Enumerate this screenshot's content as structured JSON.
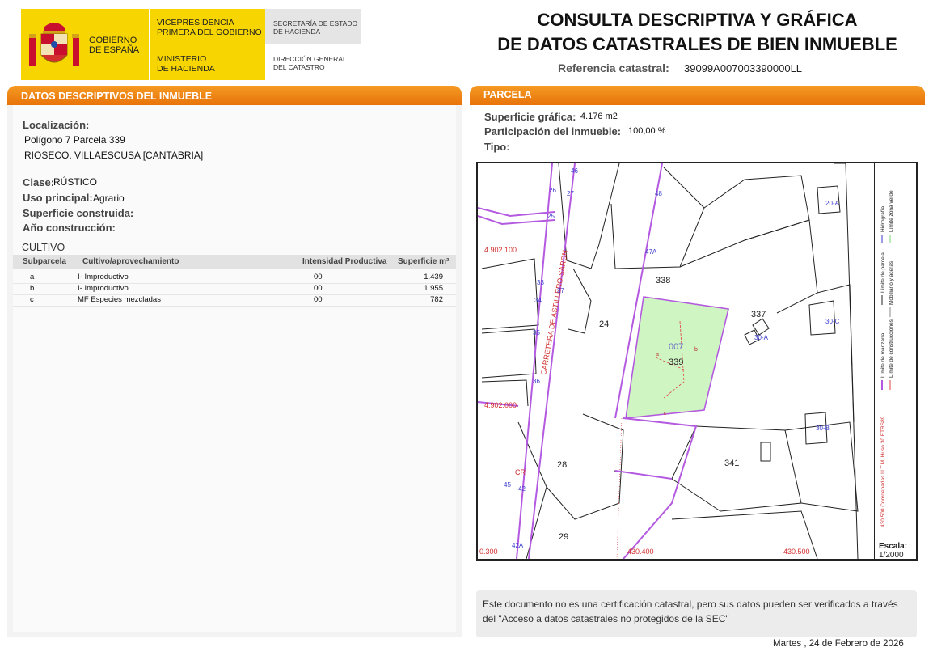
{
  "header": {
    "gobierno": [
      "GOBIERNO",
      "DE ESPAÑA"
    ],
    "vicepresidencia": [
      "VICEPRESIDENCIA",
      "PRIMERA DEL GOBIERNO"
    ],
    "ministerio": [
      "MINISTERIO",
      "DE HACIENDA"
    ],
    "secretaria": [
      "SECRETARÍA DE ESTADO",
      "DE HACIENDA"
    ],
    "direccion": [
      "DIRECCIÓN GENERAL",
      "DEL CATASTRO"
    ],
    "title_line1": "CONSULTA DESCRIPTIVA Y GRÁFICA",
    "title_line2": "DE DATOS CATASTRALES DE BIEN INMUEBLE",
    "refcat_label": "Referencia catastral:",
    "refcat_value": "39099A007003390000LL"
  },
  "left": {
    "section_title": "DATOS DESCRIPTIVOS DEL INMUEBLE",
    "localizacion_label": "Localización:",
    "localizacion_line1": "Polígono 7 Parcela 339",
    "localizacion_line2": "RIOSECO. VILLAESCUSA [CANTABRIA]",
    "clase_label": "Clase:",
    "clase_value": "RÚSTICO",
    "uso_label": "Uso principal:",
    "uso_value": "Agrario",
    "superficie_label": "Superficie construida:",
    "anio_label": "Año construcción:",
    "cultivo_title": "CULTIVO",
    "table_headers": [
      "Subparcela",
      "Cultivo/aprovechamiento",
      "Intensidad Productiva",
      "Superficie m²"
    ],
    "rows": [
      {
        "sub": "a",
        "cultivo": "I- Improductivo",
        "intensidad": "00",
        "superficie": "1.439"
      },
      {
        "sub": "b",
        "cultivo": "I- Improductivo",
        "intensidad": "00",
        "superficie": "1.955"
      },
      {
        "sub": "c",
        "cultivo": "MF Especies mezcladas",
        "intensidad": "00",
        "superficie": "782"
      }
    ]
  },
  "right": {
    "section_title": "PARCELA",
    "superficie_label": "Superficie gráfica:",
    "superficie_value": "4.176 m2",
    "participacion_label": "Participación del inmueble:",
    "participacion_value": "100,00 %",
    "tipo_label": "Tipo:"
  },
  "map": {
    "parcel_labels": [
      "338",
      "24",
      "337",
      "339",
      "28",
      "341",
      "29",
      "007"
    ],
    "subparcel_labels": [
      "a",
      "b",
      "c"
    ],
    "road_label": "CARRETERA DE ASTILLERO-SARON",
    "coord_y_top": "4.902.100",
    "coord_y_bottom": "4.902.000",
    "coord_x": [
      "0.300",
      "430.400",
      "430.500"
    ],
    "building_labels": [
      "20-A",
      "30-C",
      "30-A",
      "30-B"
    ],
    "road_numbers": [
      "46",
      "48",
      "47A",
      "26",
      "25",
      "27",
      "33",
      "34",
      "35",
      "36",
      "37",
      "42",
      "42A",
      "45",
      "CR"
    ],
    "legend_col1": [
      "Hidrografía",
      "Límite zona verde"
    ],
    "legend_col2": [
      "Límite de parcela",
      "Mobiliario y aceras"
    ],
    "legend_col3": [
      "Límite de manzana",
      "Límite de construcciones"
    ],
    "legend_col4": [
      "430.500 Coordenadas U.T.M. Huso 30 ETRS89"
    ],
    "scale_label": "Escala:",
    "scale_value": "1/2000",
    "colors": {
      "parcel_fill": "#cef5c2",
      "parcel_border": "#b45ae0",
      "road": "#b45ae0",
      "accent": "#ec7d12"
    }
  },
  "note": "Este documento no es una certificación catastral, pero sus datos pueden ser verificados a través del \"Acceso a datos catastrales no protegidos de la SEC\"",
  "date": "Martes , 24 de Febrero de 2026"
}
